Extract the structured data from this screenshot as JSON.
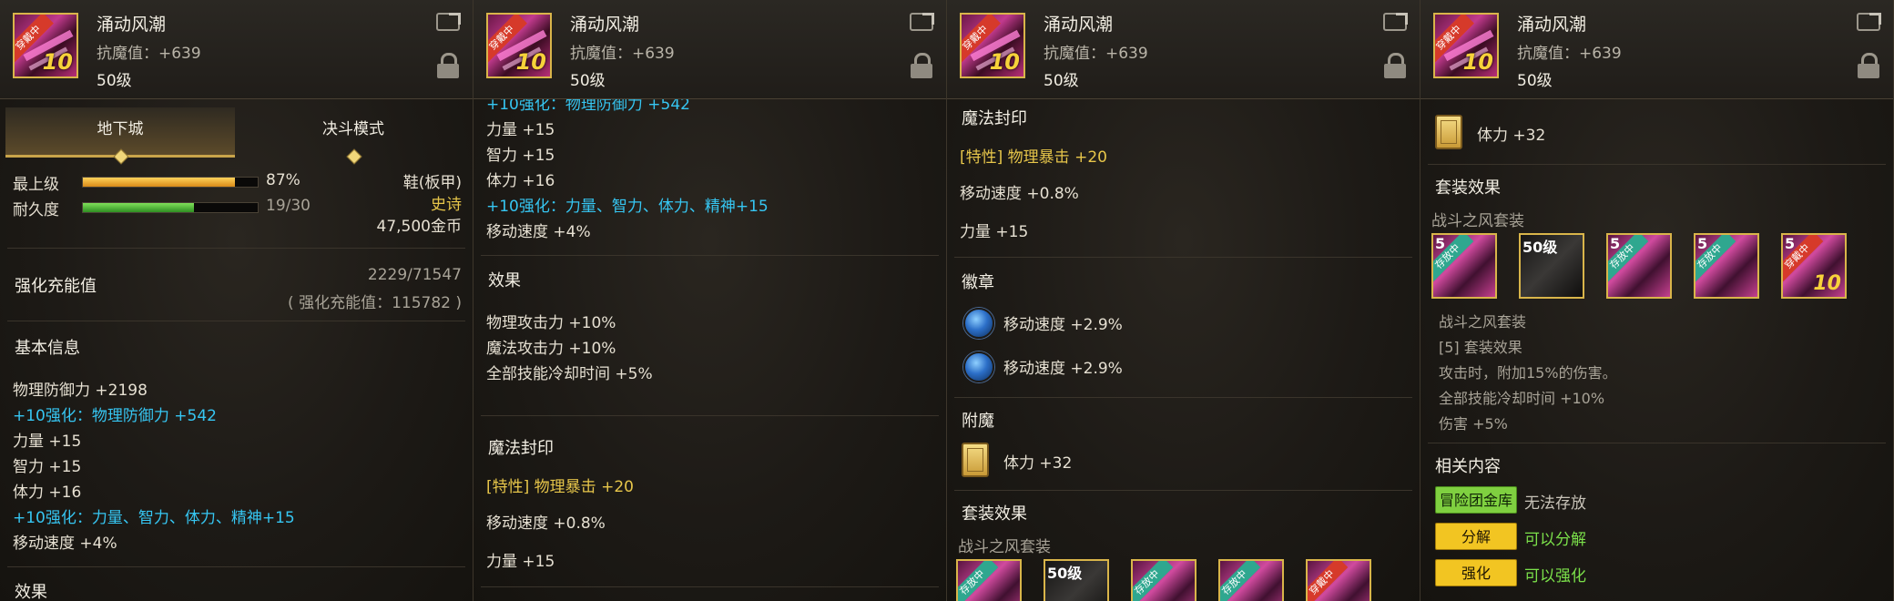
{
  "item": {
    "name": "涌动风潮",
    "magic_def": "抗魔值：+639",
    "level": "50级",
    "icon_level": "5",
    "icon_tag": "穿戴中",
    "enhance_num": "10"
  },
  "panel1": {
    "tabs": [
      "地下城",
      "决斗模式"
    ],
    "grade_label": "最上级",
    "grade_pct": "87%",
    "grade_fill": 0.87,
    "dur_label": "耐久度",
    "dur_value": "19/30",
    "dur_fill": 0.633,
    "type": "鞋(板甲)",
    "rarity": "史诗",
    "price": "47,500金币",
    "charge_label": "强化充能值",
    "charge_value": "2229/71547",
    "charge_sub": "( 强化充能值：115782 )",
    "basic_title": "基本信息",
    "stats": [
      "物理防御力 +2198",
      "+10强化：物理防御力 +542",
      "力量 +15",
      "智力 +15",
      "体力 +16",
      "+10强化：力量、智力、体力、精神+15",
      "移动速度 +4%"
    ],
    "cut_title": "效果"
  },
  "panel2": {
    "top_cut": "+10强化：物理防御力 +542",
    "stats": [
      "力量 +15",
      "智力 +15",
      "体力 +16",
      "+10强化：力量、智力、体力、精神+15",
      "移动速度 +4%"
    ],
    "effect_title": "效果",
    "effects": [
      "物理攻击力 +10%",
      "魔法攻击力 +10%",
      "全部技能冷却时间 +5%"
    ],
    "seal_title": "魔法封印",
    "seal_lines": [
      "[特性] 物理暴击 +20",
      "移动速度 +0.8%",
      "力量 +15"
    ]
  },
  "panel3": {
    "seal_title": "魔法封印",
    "seal_lines": [
      "[特性] 物理暴击 +20",
      "移动速度 +0.8%",
      "力量 +15"
    ],
    "emblem_title": "徽章",
    "emblems": [
      "移动速度 +2.9%",
      "移动速度 +2.9%"
    ],
    "enchant_title": "附魔",
    "enchant": "体力 +32",
    "set_title": "套装效果",
    "set_name": "战斗之风套装",
    "set_icon_labels": [
      "存放中",
      "50级",
      "存放中",
      "存放中",
      "穿戴中"
    ]
  },
  "panel4": {
    "enchant": "体力 +32",
    "set_title": "套装效果",
    "set_name": "战斗之风套装",
    "set_icon_labels": [
      "存放中",
      "50级",
      "存放中",
      "存放中",
      "穿戴中"
    ],
    "set_icon_levels": [
      "5",
      "",
      "5",
      "5",
      "5"
    ],
    "set_desc": [
      "战斗之风套装",
      "[5] 套装效果",
      "攻击时，附加15%的伤害。",
      "全部技能冷却时间 +10%",
      "伤害 +5%"
    ],
    "related_title": "相关内容",
    "related": [
      {
        "button": "冒险团金库",
        "text": "无法存放",
        "text_color": "#c8c3b8"
      },
      {
        "button": "分解",
        "text": "可以分解",
        "text_color": "#7be04a"
      },
      {
        "button": "强化",
        "text": "可以强化",
        "text_color": "#7be04a"
      }
    ]
  },
  "colors": {
    "stat_blue": "#36c6f2",
    "epic_gold": "#e7c64a",
    "grade_bar": "#e9a22a",
    "dur_bar": "#4fb83a",
    "badge_green": "#2fa78f",
    "badge_red": "#d63a2a"
  }
}
